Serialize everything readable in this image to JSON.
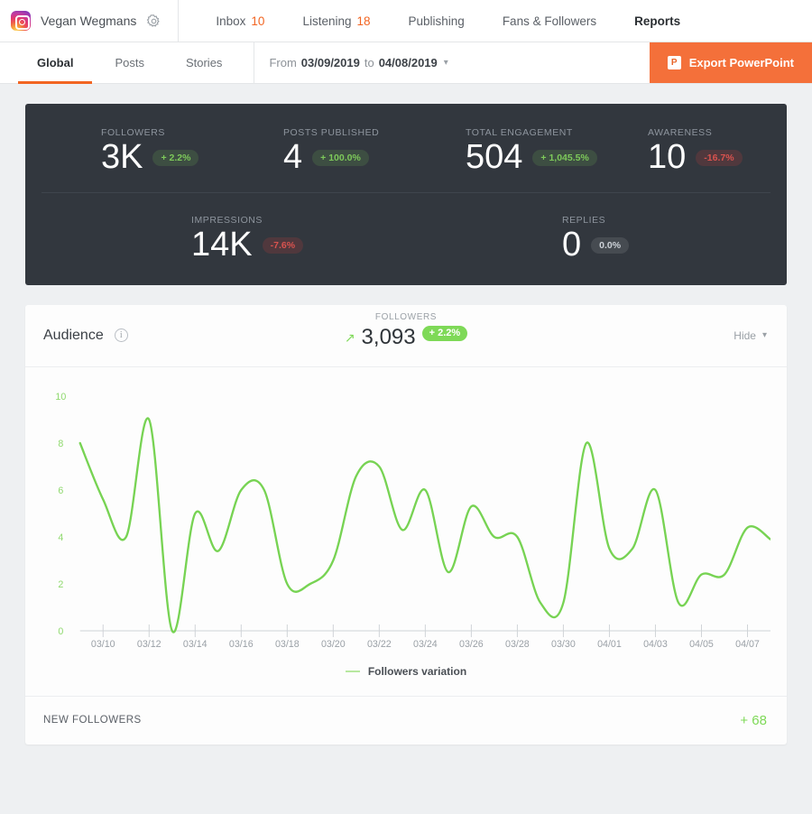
{
  "topnav": {
    "brand": {
      "name": "Vegan Wegmans",
      "logo_icon": "instagram-icon",
      "settings_icon": "gear-icon"
    },
    "tabs": [
      {
        "label": "Inbox",
        "count": "10",
        "active": false
      },
      {
        "label": "Listening",
        "count": "18",
        "active": false
      },
      {
        "label": "Publishing",
        "count": "",
        "active": false
      },
      {
        "label": "Fans & Followers",
        "count": "",
        "active": false
      },
      {
        "label": "Reports",
        "count": "",
        "active": true
      }
    ]
  },
  "subnav": {
    "tabs": [
      {
        "label": "Global",
        "active": true
      },
      {
        "label": "Posts",
        "active": false
      },
      {
        "label": "Stories",
        "active": false
      }
    ],
    "date_range": {
      "prefix": "From",
      "start": "03/09/2019",
      "middle": "to",
      "end": "04/08/2019",
      "chevron_icon": "chevron-down-icon"
    },
    "export_button": {
      "label": "Export PowerPoint",
      "icon": "powerpoint-icon",
      "icon_glyph": "P"
    }
  },
  "summary": {
    "row_top": [
      {
        "label": "FOLLOWERS",
        "value": "3K",
        "delta": "+ 2.2%",
        "trend": "up"
      },
      {
        "label": "POSTS PUBLISHED",
        "value": "4",
        "delta": "+ 100.0%",
        "trend": "up"
      },
      {
        "label": "TOTAL ENGAGEMENT",
        "value": "504",
        "delta": "+ 1,045.5%",
        "trend": "up"
      },
      {
        "label": "AWARENESS",
        "value": "10",
        "delta": "-16.7%",
        "trend": "down"
      }
    ],
    "row_bottom": [
      {
        "label": "IMPRESSIONS",
        "value": "14K",
        "delta": "-7.6%",
        "trend": "down"
      },
      {
        "label": "REPLIES",
        "value": "0",
        "delta": "0.0%",
        "trend": "flat"
      }
    ]
  },
  "audience": {
    "title": "Audience",
    "info_icon": "info-icon",
    "info_glyph": "i",
    "kpi_label": "FOLLOWERS",
    "kpi_arrow": "↗",
    "kpi_value": "3,093",
    "kpi_delta": "+ 2.2%",
    "hide_label": "Hide",
    "hide_chevron_icon": "chevron-down-icon",
    "legend_label": "Followers variation",
    "new_followers_label": "NEW FOLLOWERS",
    "new_followers_value": "+ 68"
  },
  "colors": {
    "accent_orange": "#f4703a",
    "line_green": "#77d353",
    "panel_dark": "#32373e",
    "badge_green": "#7ed957",
    "badge_red": "#d9534f"
  },
  "chart_data": {
    "type": "line",
    "title": "",
    "xlabel": "",
    "ylabel": "",
    "ylim": [
      0,
      10
    ],
    "yticks": [
      0,
      2,
      4,
      6,
      8,
      10
    ],
    "grid": false,
    "legend_position": "bottom",
    "series": [
      {
        "name": "Followers variation",
        "color": "#77d353",
        "x": [
          "03/09",
          "03/10",
          "03/11",
          "03/12",
          "03/13",
          "03/14",
          "03/15",
          "03/16",
          "03/17",
          "03/18",
          "03/19",
          "03/20",
          "03/21",
          "03/22",
          "03/23",
          "03/24",
          "03/25",
          "03/26",
          "03/27",
          "03/28",
          "03/29",
          "03/30",
          "03/31",
          "04/01",
          "04/02",
          "04/03",
          "04/04",
          "04/05",
          "04/06",
          "04/07",
          "04/08"
        ],
        "values": [
          8,
          5.6,
          4,
          9,
          0,
          5,
          3.4,
          6,
          6,
          2,
          2,
          3,
          6.6,
          7,
          4.3,
          6,
          2.5,
          5.3,
          4,
          4,
          1.2,
          1.2,
          8,
          3.5,
          3.5,
          6,
          1.2,
          2.4,
          2.4,
          4.4,
          3.9
        ]
      }
    ],
    "xtick_labels": [
      "03/10",
      "03/12",
      "03/14",
      "03/16",
      "03/18",
      "03/20",
      "03/22",
      "03/24",
      "03/26",
      "03/28",
      "03/30",
      "04/01",
      "04/03",
      "04/05",
      "04/07"
    ]
  }
}
